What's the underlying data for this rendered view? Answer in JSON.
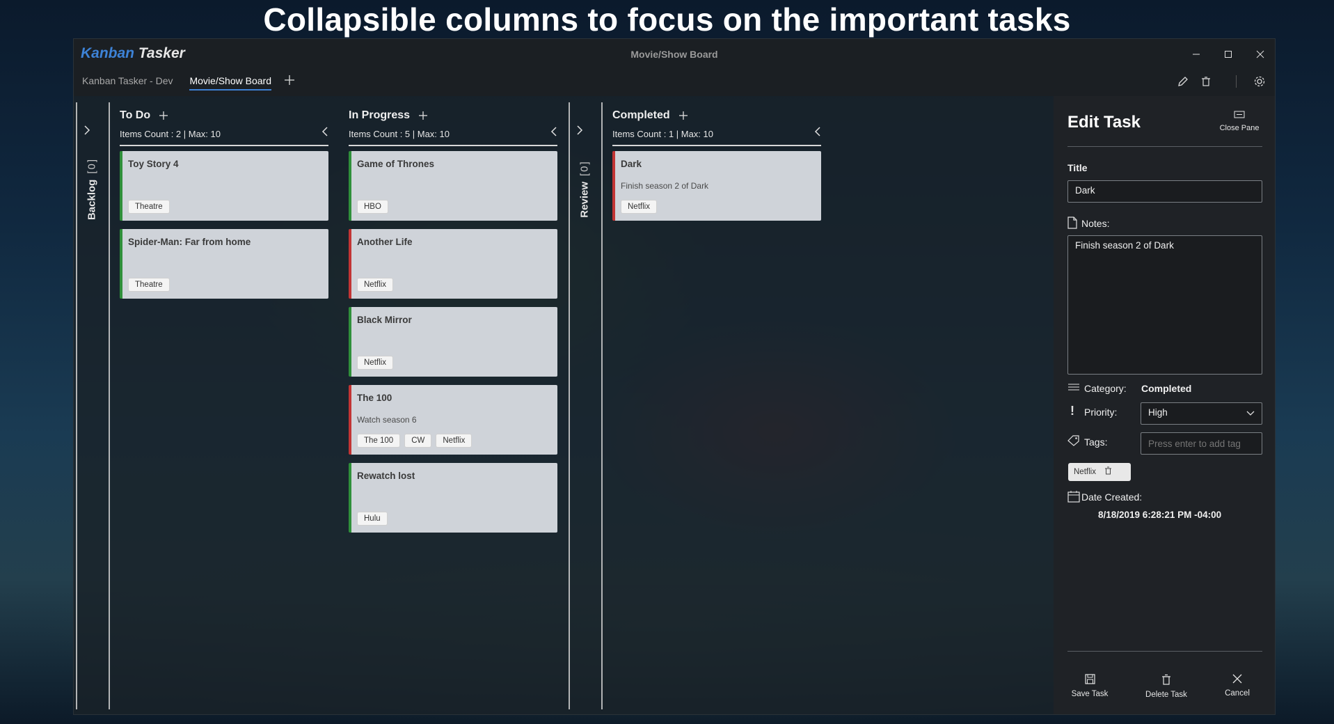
{
  "banner": "Collapsible columns to focus on the important tasks",
  "app": {
    "logo_part1": "Kanban",
    "logo_part2": "Tasker",
    "window_title": "Movie/Show Board",
    "tabs": [
      {
        "label": "Kanban Tasker - Dev"
      },
      {
        "label": "Movie/Show Board"
      }
    ]
  },
  "board": {
    "backlog": {
      "label": "Backlog",
      "count": "[0]"
    },
    "review": {
      "label": "Review",
      "count": "[0]"
    },
    "columns": [
      {
        "title": "To Do",
        "meta": "Items Count : 2  |  Max: 10",
        "cards": [
          {
            "title": "Toy Story 4",
            "note": "",
            "tags": [
              "Theatre"
            ],
            "priority_color": "green"
          },
          {
            "title": "Spider-Man: Far from home",
            "note": "",
            "tags": [
              "Theatre"
            ],
            "priority_color": "green"
          }
        ]
      },
      {
        "title": "In Progress",
        "meta": "Items Count : 5  |  Max: 10",
        "cards": [
          {
            "title": "Game of Thrones",
            "note": "",
            "tags": [
              "HBO"
            ],
            "priority_color": "green"
          },
          {
            "title": "Another Life",
            "note": "",
            "tags": [
              "Netflix"
            ],
            "priority_color": "red"
          },
          {
            "title": "Black Mirror",
            "note": "",
            "tags": [
              "Netflix"
            ],
            "priority_color": "green"
          },
          {
            "title": "The 100",
            "note": "Watch season 6",
            "tags": [
              "The 100",
              "CW",
              "Netflix"
            ],
            "priority_color": "red"
          },
          {
            "title": "Rewatch lost",
            "note": "",
            "tags": [
              "Hulu"
            ],
            "priority_color": "green"
          }
        ]
      },
      {
        "title": "Completed",
        "meta": "Items Count : 1  |  Max: 10",
        "cards": [
          {
            "title": "Dark",
            "note": "Finish season 2 of Dark",
            "tags": [
              "Netflix"
            ],
            "priority_color": "red"
          }
        ]
      }
    ]
  },
  "edit_pane": {
    "header": "Edit Task",
    "close_label": "Close Pane",
    "title_label": "Title",
    "title_value": "Dark",
    "notes_label": "Notes:",
    "notes_value": "Finish season 2 of Dark",
    "category_label": "Category:",
    "category_value": "Completed",
    "priority_label": "Priority:",
    "priority_value": "High",
    "tags_label": "Tags:",
    "tags_placeholder": "Press enter to add tag",
    "tags": [
      "Netflix"
    ],
    "date_label": "Date Created:",
    "date_value": "8/18/2019 6:28:21 PM -04:00",
    "save_label": "Save Task",
    "delete_label": "Delete Task",
    "cancel_label": "Cancel"
  },
  "colors": {
    "accent": "#3d82d6",
    "priority_high": "#c23434",
    "priority_low": "#2f8f3a",
    "card_bg": "#cfd3d9"
  }
}
